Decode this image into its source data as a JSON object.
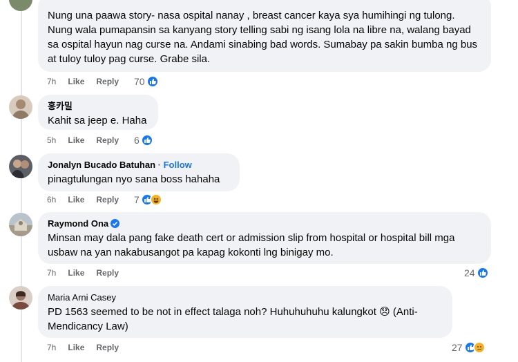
{
  "comments": [
    {
      "author": "",
      "text": "Nung una paawa story- nasa ospital nanay , breast cancer kaya sya humihingi ng tulong. Nung wala pumapansin sa kanyang story telling sabi ng isang lola na libre na, walang bayad sa ospital hayun nag curse na. Andami sinabing bad words. Sumabay pa sakin bumba ng bus at tuloy tuloy pag curse. Grabe sila.",
      "time": "7h",
      "like": "Like",
      "reply": "Reply",
      "reactions": "70",
      "reaction_icons": [
        "like-icon"
      ]
    },
    {
      "author": "홍카밀",
      "text": "Kahit sa jeep e. Haha",
      "time": "5h",
      "like": "Like",
      "reply": "Reply",
      "reactions": "6",
      "reaction_icons": [
        "like-icon"
      ]
    },
    {
      "author": "Jonalyn Bucado Batuhan",
      "follow": "Follow",
      "text": "pinagtulungan nyo sana boss hahaha",
      "time": "6h",
      "like": "Like",
      "reply": "Reply",
      "reactions": "7",
      "reaction_icons": [
        "like-icon",
        "haha-icon"
      ]
    },
    {
      "author": "Raymond Ona",
      "verified": true,
      "text": "Minsan may dala pang fake death cert or admission slip from hospital or hospital bill mga usbaw na yan nakabusangot pa kapag kokonti lng binigay mo.",
      "time": "7h",
      "like": "Like",
      "reply": "Reply",
      "reactions": "24",
      "reaction_icons": [
        "like-icon"
      ]
    },
    {
      "author": "Maria Arni Casey",
      "text": "PD 1563 seemed to be not in effect talaga noh? Huhuhuhuhu kalungkot 😞 (Anti-Mendicancy Law)",
      "time": "7h",
      "like": "Like",
      "reply": "Reply",
      "reactions": "27",
      "reaction_icons": [
        "like-icon",
        "sad-icon"
      ]
    }
  ],
  "colors": {
    "bubble": "#f0f2f5",
    "link": "#1b74e4",
    "like": "#1877f2",
    "meta": "#65676b"
  }
}
